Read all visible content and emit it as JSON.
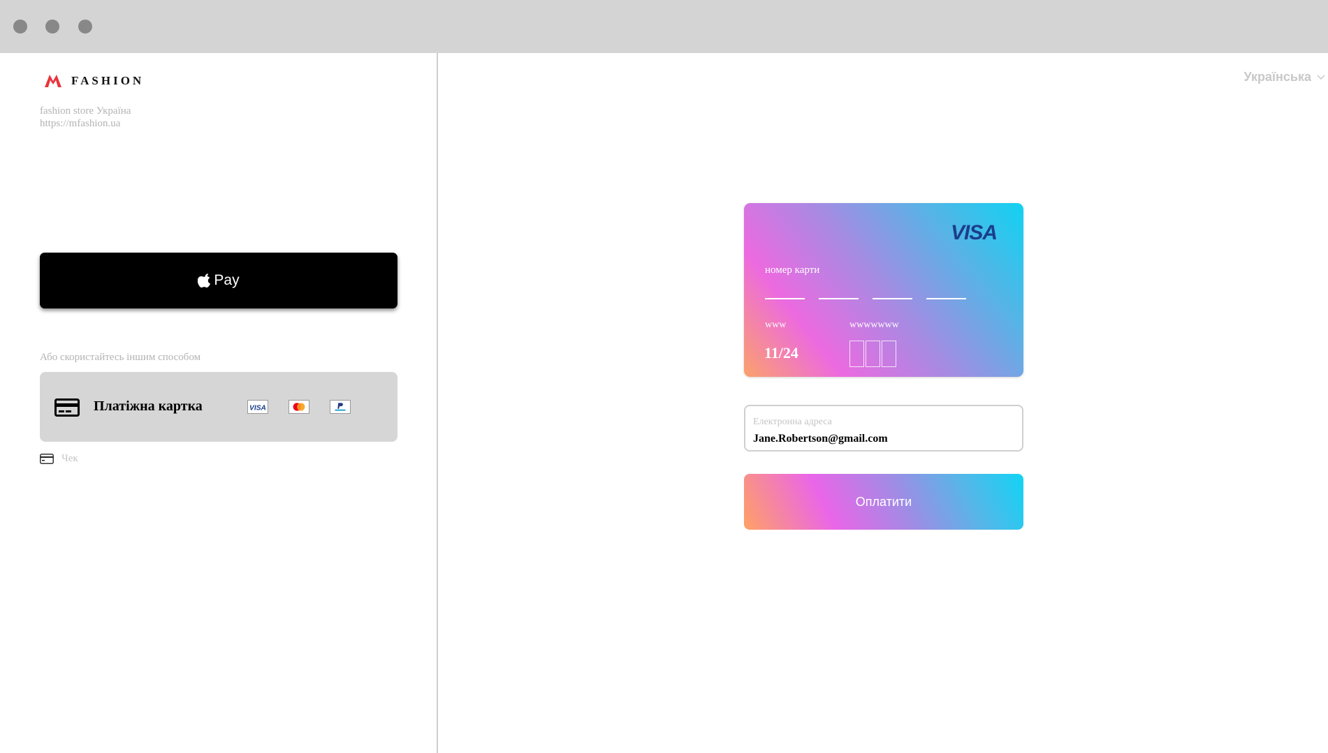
{
  "window": {
    "controls": [
      "close-dot",
      "minimize-dot",
      "maximize-dot"
    ],
    "control_color": "#888888",
    "titlebar_color": "#d4d4d4"
  },
  "merchant": {
    "logo_text": "FASHION",
    "logo_color": "#e8343c",
    "store_name": "fashion store Україна",
    "url": "https://mfashion.ua"
  },
  "apple_pay": {
    "label": "Pay",
    "icon": "apple-icon"
  },
  "alternative_label": "Або скористайтесь іншим способом",
  "payment_method": {
    "label": "Платіжна картка",
    "icon": "credit-card-icon",
    "brands": [
      "visa-icon",
      "mastercard-icon",
      "paypal-icon"
    ]
  },
  "receipt": {
    "label": "Чек",
    "icon": "receipt-card-icon"
  },
  "language": {
    "selected": "Українська",
    "icon": "chevron-down-icon"
  },
  "card_preview": {
    "brand": "VISA",
    "number_label": "номер карти",
    "expiry_label": "www",
    "expiry_value": "11/24",
    "cvv_label": "wwwwwww"
  },
  "email": {
    "label": "Електронна адреса",
    "value": "Jane.Robertson@gmail.com"
  },
  "pay_button": {
    "label": "Оплатити"
  }
}
